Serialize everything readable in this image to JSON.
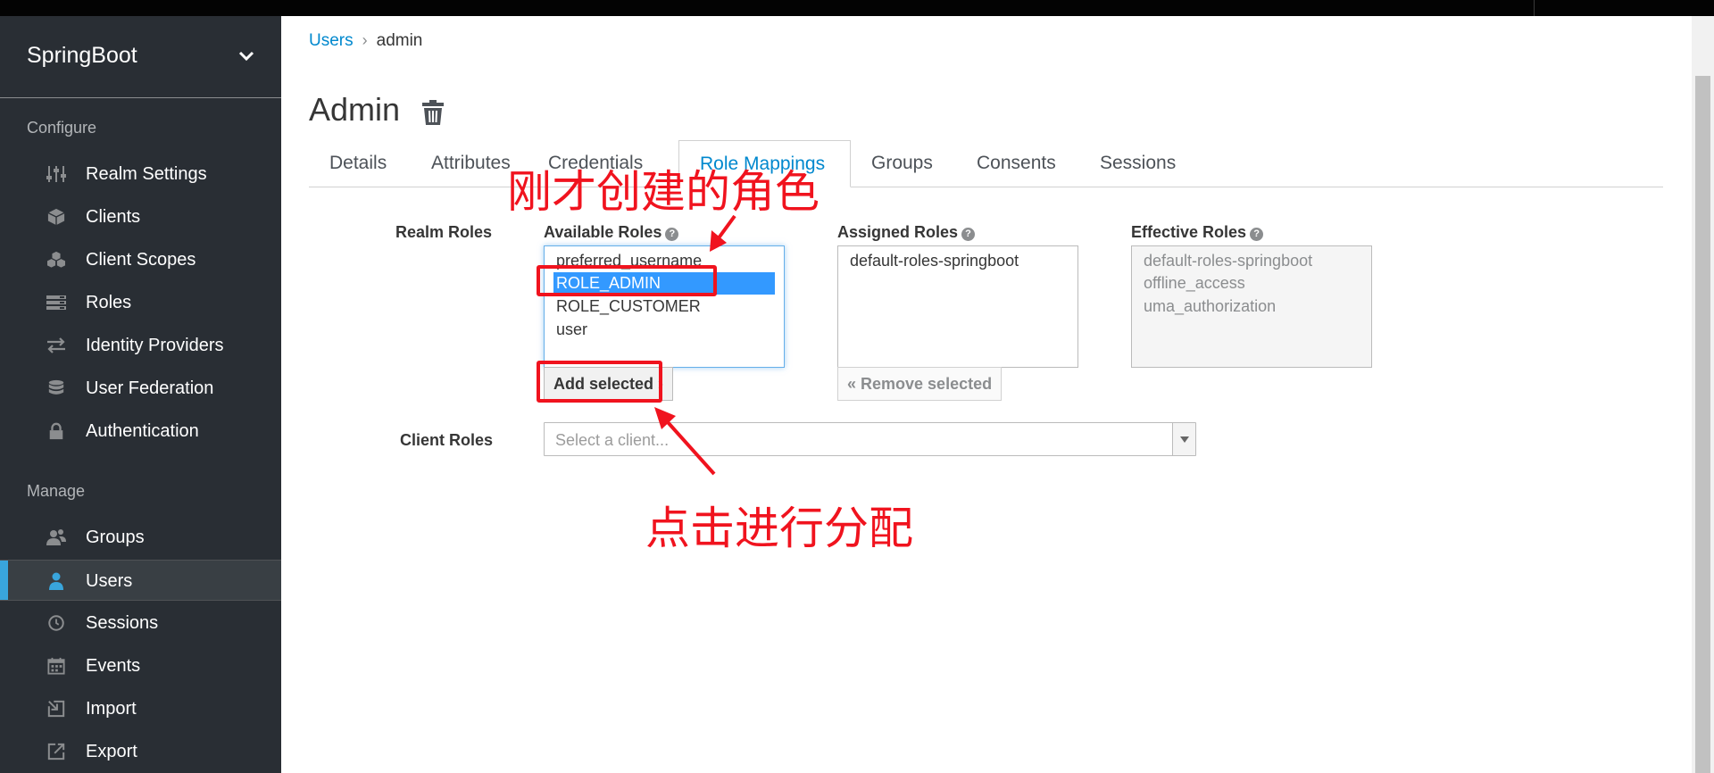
{
  "realm": {
    "name": "SpringBoot"
  },
  "sidebar": {
    "configure_title": "Configure",
    "configure_items": [
      {
        "label": "Realm Settings",
        "icon": "sliders-icon"
      },
      {
        "label": "Clients",
        "icon": "cube-icon"
      },
      {
        "label": "Client Scopes",
        "icon": "cubes-icon"
      },
      {
        "label": "Roles",
        "icon": "list-icon"
      },
      {
        "label": "Identity Providers",
        "icon": "exchange-icon"
      },
      {
        "label": "User Federation",
        "icon": "database-icon"
      },
      {
        "label": "Authentication",
        "icon": "lock-icon"
      }
    ],
    "manage_title": "Manage",
    "manage_items": [
      {
        "label": "Groups",
        "icon": "users-icon"
      },
      {
        "label": "Users",
        "icon": "user-icon",
        "active": true
      },
      {
        "label": "Sessions",
        "icon": "clock-icon"
      },
      {
        "label": "Events",
        "icon": "calendar-icon"
      },
      {
        "label": "Import",
        "icon": "import-icon"
      },
      {
        "label": "Export",
        "icon": "export-icon"
      }
    ]
  },
  "breadcrumb": {
    "parent": "Users",
    "separator": "›",
    "current": "admin"
  },
  "page": {
    "title": "Admin"
  },
  "tabs": [
    {
      "label": "Details"
    },
    {
      "label": "Attributes"
    },
    {
      "label": "Credentials"
    },
    {
      "label": "Role Mappings",
      "active": true
    },
    {
      "label": "Groups"
    },
    {
      "label": "Consents"
    },
    {
      "label": "Sessions"
    }
  ],
  "role_mappings": {
    "realm_roles_label": "Realm Roles",
    "available": {
      "label": "Available Roles",
      "options": [
        "preferred_username",
        "ROLE_ADMIN",
        "ROLE_CUSTOMER",
        "user"
      ],
      "selected": "ROLE_ADMIN"
    },
    "assigned": {
      "label": "Assigned Roles",
      "options": [
        "default-roles-springboot"
      ]
    },
    "effective": {
      "label": "Effective Roles",
      "options": [
        "default-roles-springboot",
        "offline_access",
        "uma_authorization"
      ]
    },
    "add_button": "Add selected ›",
    "remove_button": "« Remove selected",
    "client_roles_label": "Client Roles",
    "client_select_placeholder": "Select a client..."
  },
  "annotations": {
    "role_note": "刚才创建的角色",
    "click_note": "点击进行分配",
    "color": "#f0131e"
  },
  "colors": {
    "sidebar_bg": "#292e34",
    "accent": "#0088ce",
    "active_bar": "#39a5dc"
  }
}
